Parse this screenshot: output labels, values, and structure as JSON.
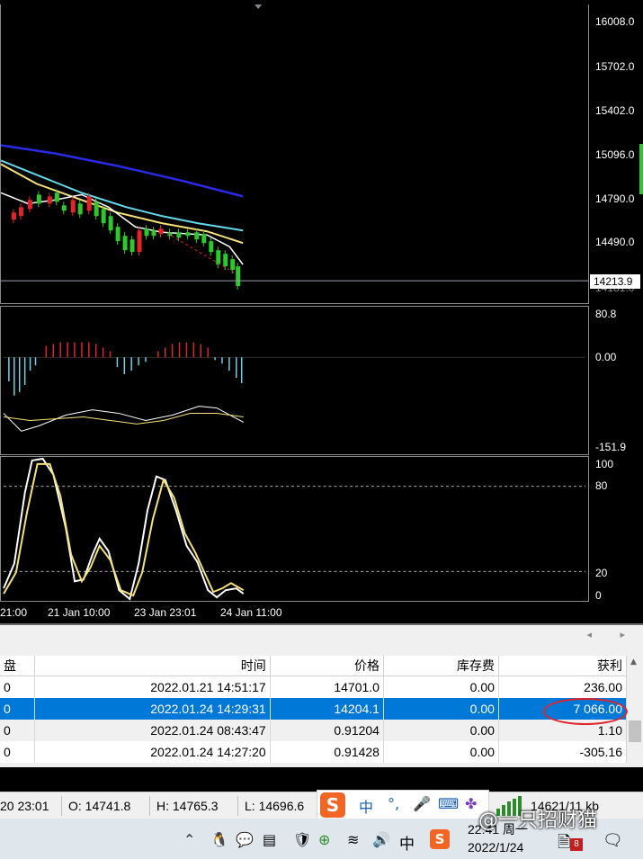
{
  "main_chart": {
    "price_labels": [
      "16008.0",
      "15702.0",
      "15402.0",
      "15096.0",
      "14790.0",
      "14490.0",
      "14181.0"
    ],
    "current_price": "14213.9"
  },
  "macd": {
    "labels": [
      "80.8",
      "0.00",
      "-151.9"
    ]
  },
  "stochastic": {
    "labels": [
      "100",
      "80",
      "20",
      "0"
    ]
  },
  "time_axis": {
    "labels": [
      "21:00",
      "21 Jan 10:00",
      "23 Jan 23:01",
      "24 Jan 11:00"
    ]
  },
  "terminal": {
    "scroll_arrows": "◂ ▸",
    "columns": [
      "盘",
      "时间",
      "价格",
      "库存费",
      "获利"
    ],
    "rows": [
      {
        "c0": "0",
        "time": "2022.01.21 14:51:17",
        "price": "14701.0",
        "swap": "0.00",
        "profit": "236.00"
      },
      {
        "c0": "0",
        "time": "2022.01.24 14:29:31",
        "price": "14204.1",
        "swap": "0.00",
        "profit": "7 066.00"
      },
      {
        "c0": "0",
        "time": "2022.01.24 08:43:47",
        "price": "0.91204",
        "swap": "0.00",
        "profit": "1.10"
      },
      {
        "c0": "0",
        "time": "2022.01.24 14:27:20",
        "price": "0.91428",
        "swap": "0.00",
        "profit": "-305.16"
      }
    ]
  },
  "status_bar": {
    "time": "20 23:01",
    "open": "O: 14741.8",
    "high": "H: 14765.3",
    "low": "L: 14696.6",
    "net": "14621/11 kb"
  },
  "ime": {
    "lang": "中",
    "punct": "°,",
    "mic": "🎤",
    "kbd": "⌨",
    "apps": "✤"
  },
  "watermark": "@一只招财猫",
  "taskbar": {
    "clock_time": "22:41 周一",
    "clock_date": "2022/1/24",
    "tray_lang": "中",
    "notification_count": "8"
  },
  "colors": {
    "bull": "#2fc72f",
    "bear": "#e0242a",
    "sma_white": "#ffffff",
    "sma_yellow": "#f6e27a",
    "sma_cyan": "#62d8e8",
    "sma_blue": "#2a2ae6",
    "selected_row": "#0078d7"
  }
}
